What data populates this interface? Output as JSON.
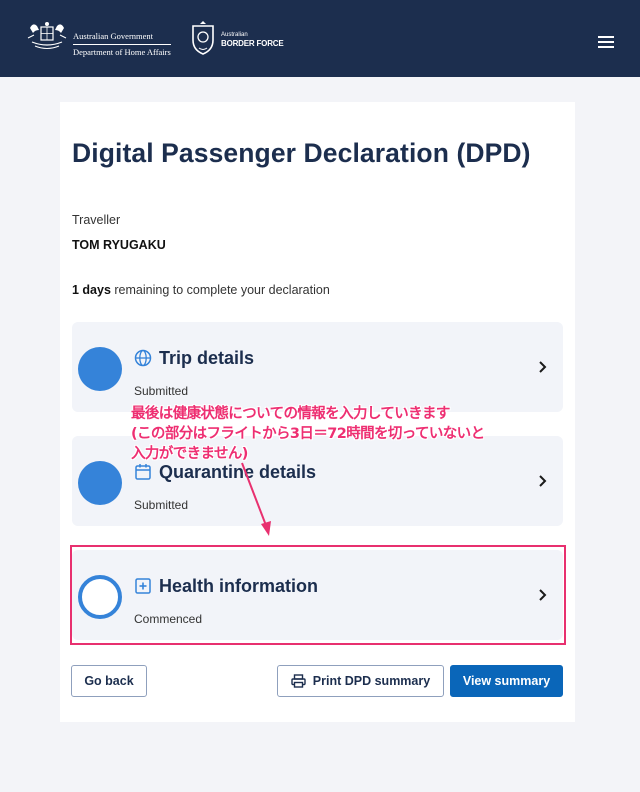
{
  "header": {
    "gov_line1": "Australian Government",
    "gov_line2": "Department of Home Affairs",
    "abf_small": "Australian",
    "abf_big": "BORDER FORCE",
    "menu_icon": "hamburger-menu-icon"
  },
  "page": {
    "title": "Digital Passenger Declaration (DPD)",
    "traveller_label": "Traveller",
    "traveller_name": "TOM RYUGAKU",
    "remaining_days": "1 days",
    "remaining_text": " remaining to complete your declaration"
  },
  "steps": [
    {
      "title": "Trip details",
      "status": "Submitted",
      "icon": "globe-icon",
      "state": "complete"
    },
    {
      "title": "Quarantine details",
      "status": "Submitted",
      "icon": "calendar-icon",
      "state": "complete"
    },
    {
      "title": "Health information",
      "status": "Commenced",
      "icon": "plus-square-icon",
      "state": "in-progress"
    }
  ],
  "buttons": {
    "back": "Go back",
    "print": "Print DPD summary",
    "view": "View summary"
  },
  "annotation": {
    "line1": "最後は健康状態についての情報を入力していきます",
    "line2": "(この部分はフライトから3日＝72時間を切っていないと",
    "line3": "入力ができません)"
  },
  "colors": {
    "navy": "#1c2e4e",
    "accent_blue": "#3583d9",
    "primary_button": "#0a66b9",
    "annotation_pink": "#ee2f72"
  }
}
